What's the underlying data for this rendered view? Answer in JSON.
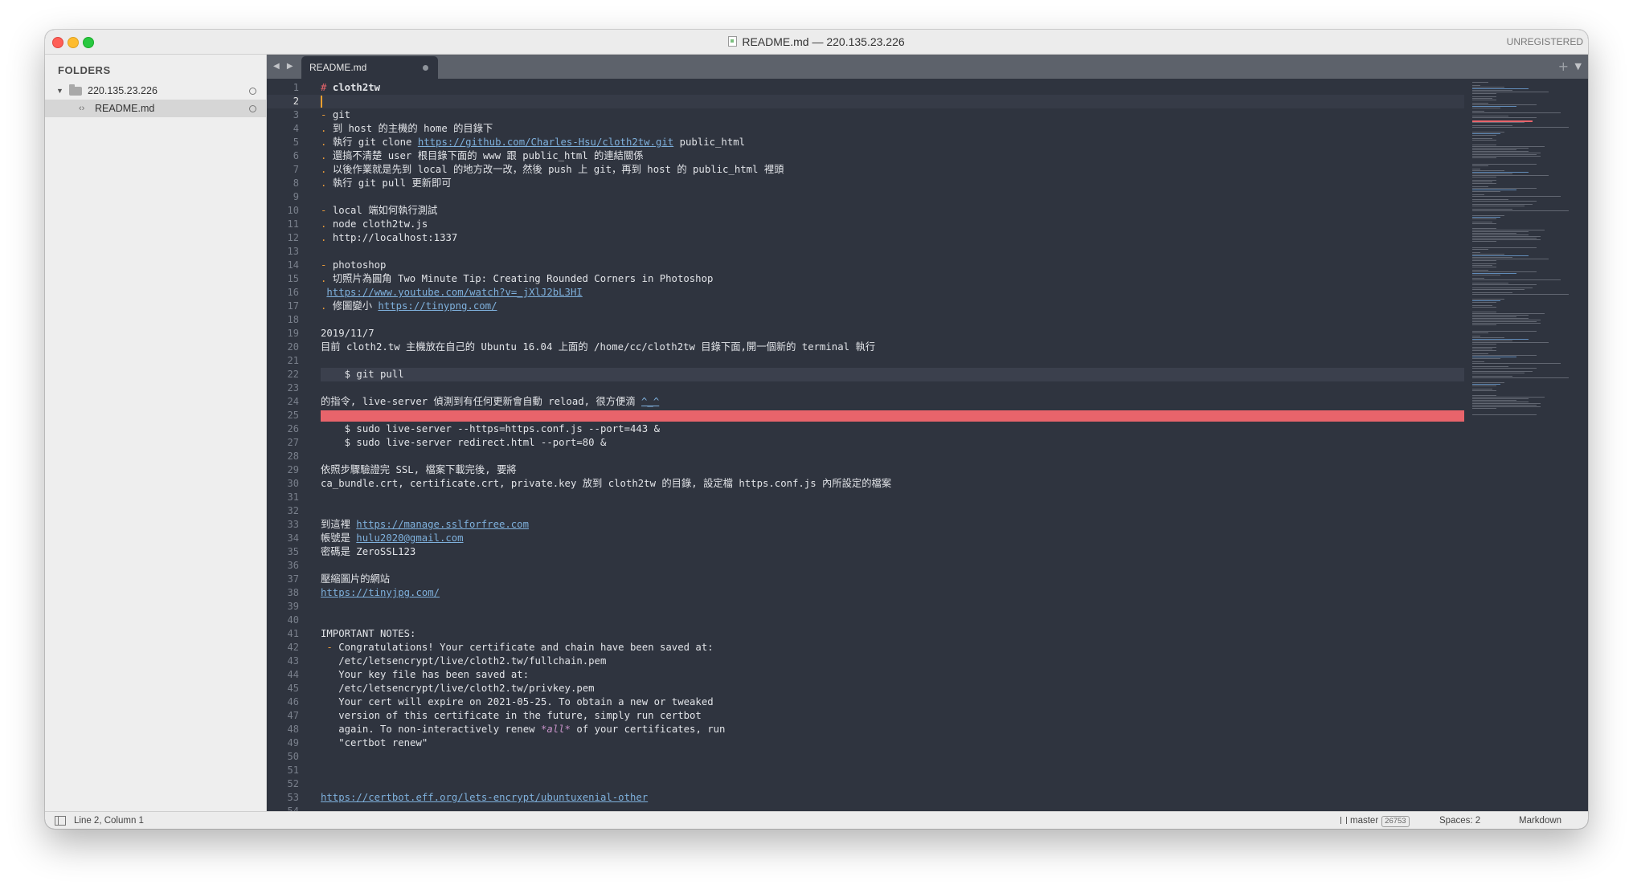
{
  "window": {
    "title": "README.md — 220.135.23.226",
    "unregistered": "UNREGISTERED"
  },
  "sidebar": {
    "heading": "FOLDERS",
    "folder": "220.135.23.226",
    "file": "README.md"
  },
  "tabs": {
    "nav": "◀ ▶",
    "active": "README.md",
    "plus": "+",
    "menu": "▼"
  },
  "status": {
    "position": "Line 2, Column 1",
    "branch": "master",
    "branch_count": "26753",
    "spaces": "Spaces: 2",
    "syntax": "Markdown"
  },
  "code": {
    "l1": "cloth2tw",
    "l3": "git",
    "l4": "到 host 的主機的 home 的目錄下",
    "l5a": "執行 git clone ",
    "l5link": "https://github.com/Charles-Hsu/cloth2tw.git",
    "l5b": " public_html",
    "l6": "還搞不清楚 user 根目錄下面的 www 跟 public_html 的連結關係",
    "l7": "以後作業就是先到 local 的地方改一改，然後 push 上 git，再到 host 的 public_html 裡頭",
    "l8": "執行 git pull 更新即可",
    "l10": "local 端如何執行測試",
    "l11": "node cloth2tw.js",
    "l12": "http://localhost:1337",
    "l14": "photoshop",
    "l15": "切照片為圓角 Two Minute Tip: Creating Rounded Corners in Photoshop",
    "l16link": "https://www.youtube.com/watch?v=_jXlJ2bL3HI",
    "l17a": "修圖變小 ",
    "l17link": "https://tinypng.com/",
    "l19": "2019/11/7",
    "l20": "目前 cloth2.tw 主機放在自己的 Ubuntu 16.04 上面的 /home/cc/cloth2tw 目錄下面,開一個新的 terminal 執行",
    "l22": "    $ git pull",
    "l24a": "的指令, live-server 偵測到有任何更新會自動 reload, 很方便滴 ",
    "l24b": "^_^",
    "l26": "    $ sudo live-server --https=https.conf.js --port=443 &",
    "l27": "    $ sudo live-server redirect.html --port=80 &",
    "l29": "依照步驟驗證完 SSL, 檔案下載完後, 要將",
    "l30": "ca_bundle.crt, certificate.crt, private.key 放到 cloth2tw 的目錄, 設定檔 https.conf.js 內所設定的檔案",
    "l33a": "到這裡 ",
    "l33link": "https://manage.sslforfree.com",
    "l34a": "帳號是 ",
    "l34link": "hulu2020@gmail.com",
    "l35": "密碼是 ZeroSSL123",
    "l37": "壓縮圖片的網站",
    "l38link": "https://tinyjpg.com/",
    "l41": "IMPORTANT NOTES:",
    "l42": "Congratulations! Your certificate and chain have been saved at:",
    "l43": "   /etc/letsencrypt/live/cloth2.tw/fullchain.pem",
    "l44": "   Your key file has been saved at:",
    "l45": "   /etc/letsencrypt/live/cloth2.tw/privkey.pem",
    "l46": "   Your cert will expire on 2021-05-25. To obtain a new or tweaked",
    "l47": "   version of this certificate in the future, simply run certbot",
    "l48a": "   again. To non-interactively renew ",
    "l48b": "*all*",
    "l48c": " of your certificates, run",
    "l49": "   \"certbot renew\"",
    "l53link": "https://certbot.eff.org/lets-encrypt/ubuntuxenial-other"
  }
}
